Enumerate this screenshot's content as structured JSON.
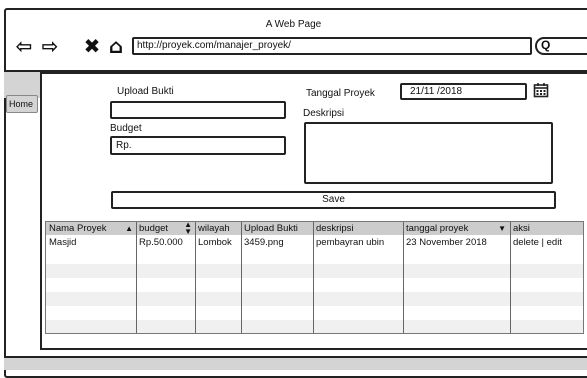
{
  "browser": {
    "title": "A Web Page",
    "url": "http://proyek.com/manajer_proyek/",
    "search_glyph": "Q"
  },
  "sidebar": {
    "home_label": "Home"
  },
  "form": {
    "upload_label": "Upload Bukti",
    "upload_value": "",
    "budget_label": "Budget",
    "budget_value": "Rp.",
    "date_label": "Tanggal Proyek",
    "date_value": "21/11 /2018",
    "description_label": "Deskripsi",
    "description_value": "",
    "save_label": "Save"
  },
  "table": {
    "headers": [
      "Nama Proyek",
      "budget",
      "wilayah",
      "Upload Bukti",
      "deskripsi",
      "tanggal proyek",
      "aksi"
    ],
    "rows": [
      [
        "Masjid",
        "Rp.50.000",
        "Lombok",
        "3459.png",
        "pembayran ubin",
        "23 November 2018",
        "delete | edit"
      ]
    ]
  }
}
